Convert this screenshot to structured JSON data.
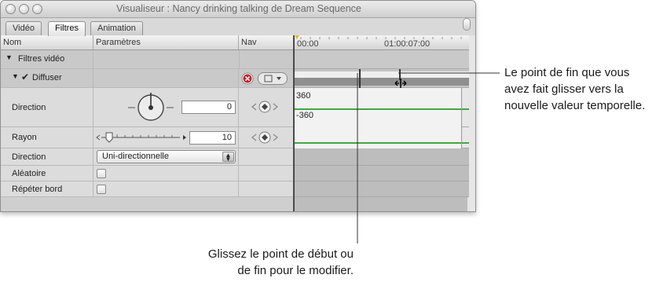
{
  "window": {
    "title": "Visualiseur : Nancy drinking talking de Dream Sequence",
    "tabs": [
      {
        "label": "Vidéo",
        "active": false
      },
      {
        "label": "Filtres",
        "active": true
      },
      {
        "label": "Animation",
        "active": false
      }
    ]
  },
  "columns": {
    "name": "Nom",
    "params": "Paramètres",
    "nav": "Nav"
  },
  "ruler": {
    "start": "00:00",
    "mid": "01:00:07:00"
  },
  "groups": {
    "video_filters": "Filtres vidéo",
    "filter_name": "Diffuser"
  },
  "params": {
    "direction_label": "Direction",
    "direction_value": "0",
    "radius_label": "Rayon",
    "radius_value": "10",
    "direction2_label": "Direction",
    "direction2_value": "Uni-directionnelle",
    "random_label": "Aléatoire",
    "repeat_label": "Répéter bord"
  },
  "graph": {
    "max_label": "360",
    "min_label": "-360"
  },
  "callouts": {
    "end_point": "Le point de fin que vous avez fait glisser vers la nouvelle valeur temporelle.",
    "drag_point_line1": "Glissez le point de début ou",
    "drag_point_line2": "de fin pour le modifier."
  },
  "colors": {
    "graph_line": "#46a546",
    "marker_red": "#c0262c",
    "window_bg": "#e6e6e6"
  }
}
